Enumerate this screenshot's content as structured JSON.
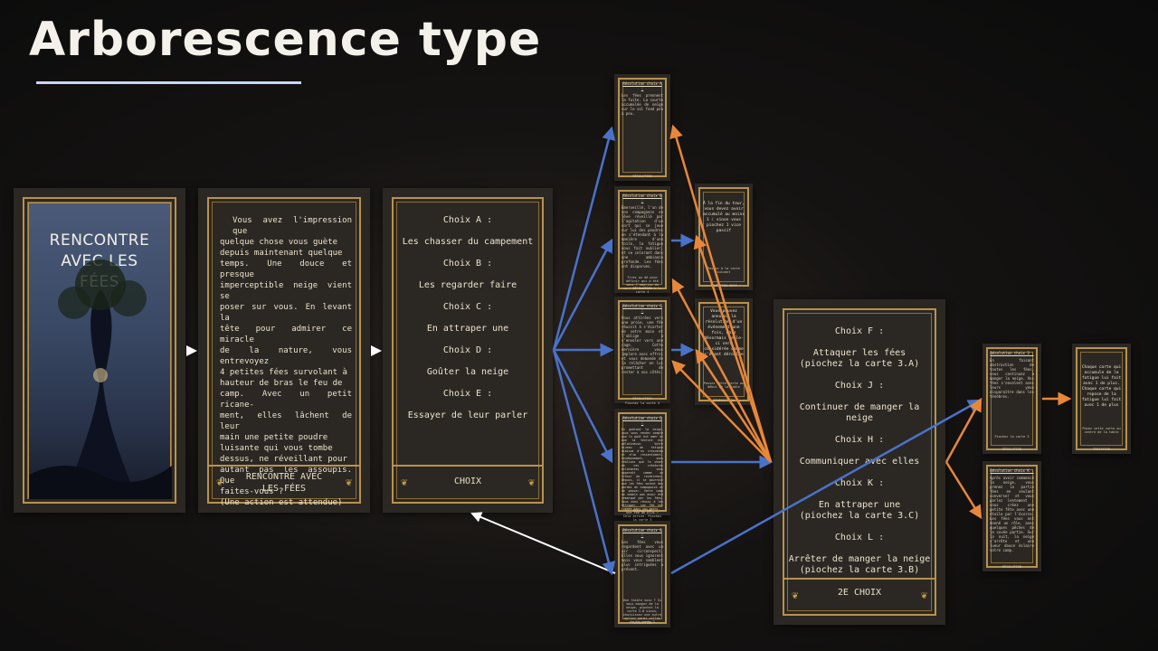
{
  "title": "Arborescence type",
  "cover": {
    "title_lines": [
      "RENCONTRE",
      "AVEC LES",
      "FÉES"
    ]
  },
  "intro": {
    "lines": [
      "Vous avez l'impression que",
      "quelque chose vous guète",
      "depuis maintenant quelque",
      "temps. Une douce et presque",
      "imperceptible neige vient se",
      "poser sur vous. En levant la",
      "tête pour admirer ce miracle",
      "de la nature, vous entrevoyez",
      "4 petites fées survolant à",
      "hauteur de bras le feu de",
      "camp. Avec un petit ricane-",
      "ment, elles lâchent de leur",
      "main une petite poudre",
      "luisante qui vous tombe",
      "dessus, ne réveillant pour",
      "autant pas les assoupis. Que",
      "faites-vous ?",
      "(Une action est attendue)"
    ],
    "footer": [
      "RENCONTRE AVEC",
      "LES FÉES"
    ]
  },
  "choices1": {
    "lines": [
      "Choix A :",
      "Les chasser du campement",
      "Choix B :",
      "Les regarder faire",
      "Choix C :",
      "En attraper une",
      "Choix D :",
      "Goûter la neige",
      "Choix E :",
      "Essayer de leur parler"
    ],
    "footer": "CHOIX"
  },
  "results": [
    {
      "head": "Résolution choix A :",
      "text": "Les fées prennent la fuite. La courte accumulée de neige sur le sol fond peu à peu.",
      "foot": "RÉSOLUTION"
    },
    {
      "head": "Résolution choix B :",
      "text": "Émerveillé, l'un de vos compagnons se lève réveillé par l'agitation d'un sort qui se joue sur lui des poudres en s'étendant à la manière d'une toile, la fatigue vous fait oublier, et se colorant dans une ambiance profonde. Les fées ont disparues.",
      "action": "Tirez au dé pour définir qui a été sous l'emprise du sort et Avancez à la carte 4",
      "foot": "RÉSOLUTION"
    },
    {
      "head": "Résolution choix C :",
      "text": "Vous attirées vers une proie, une fée réussit à s'écarter de votre main et l'oblige à s'envoler vers une rage. Cette dernière vous implore avec effroi et vous demande de la relâcher en lui promettant de rester à vos côtés.",
      "action": "Piochez la carte 4",
      "foot": "RÉSOLUTION"
    },
    {
      "head": "Résolution choix D :",
      "text": "En goûtant la neige, vous vous rendez compte que le goût est amer et que la texture est gélatineuse. Votre niveau de fatigue diminue d'un crescendo et d'un ressentiment. Soudainement, vous réalisez que le chant de ces créatures éclatantes vous apparaît comme un trésor de recherches. Depuis, il se pourrait que les fées soient des gardes de compagnies et de passer. Votre camp ne semble pas avoir été remarqué par les fées. Vous avez réussi à les attraper, une fée est tombée dans vos mains.",
      "action": "Une fée de plus ? Cela arrive. Piochez la carte 5",
      "foot": "RÉSOLUTION"
    },
    {
      "head": "Résolution choix E :",
      "text": "Les fées vous regardent avec un air circonspect. Elles vous ignorent mais vous semblent plus intriguées à présent.",
      "action": "Une faible voix ? Si vous mangez de la neige, piochez la carte 3.B sinon, choisissez une autre option parmi celles de la carte 3",
      "foot": "RÉSOLUTION"
    }
  ],
  "mid": [
    {
      "text": "À la fin du tour, vous devez avoir accumulé au moins 1 ☾ sinon vous piochez 1 vice passif",
      "action": "Passez à la carte suivant",
      "foot": "TENTATION 9BIS"
    },
    {
      "text": "Vous pouvez annuler la résolution d'un événement une fois, mais désormais celle-ci sera considérée comme s'étant déroulée",
      "action": "Passez cette carte au début de la table",
      "foot": "BÉNÉDICTION"
    }
  ],
  "choices2": {
    "lines": [
      "Choix F :",
      "Attaquer les fées",
      "(piochez la carte 3.A)",
      "Choix J :",
      "Continuer de manger la neige",
      "Choix H :",
      "Communiquer avec elles",
      "Choix K :",
      "En attraper une",
      "(piochez la carte 3.C)",
      "Choix L :",
      "Arrêter de manger la neige",
      "(piochez la carte 3.B)"
    ],
    "footer": "2E CHOIX"
  },
  "right": [
    {
      "head": "Résolution choix 3 :",
      "text": "En faisant abstraction de toutes les fées, vous continuez à manger la neige. Vos fées s'envolent avec leurs yeux disparaître dans les ténèbres.",
      "action": "Piochez la carte 3",
      "foot": "RÉSOLUTION"
    },
    {
      "head": "Résolution choix K :",
      "text": "Après avoir commencé la neige, vous prenez la partie fées en voulant converser et vous parlez lentement : vous créez une petite fête avec une étoile par l'écorce. Les fées vous ont donné un rôle, avec quelques pêches de la cuvée partie. Sur la nuit, la neige s'arrête et une lueur douce éclaire votre camp.",
      "foot": "RÉSOLUTION"
    },
    {
      "text": "Chaque carte qui accumule de la fatigue lui fait avec 1 de plus. Chaque carte qui repose de la fatigue lui fait avec 1 de plus",
      "action": "Posez cette carte au centre de la table",
      "foot": "TENTATION"
    }
  ],
  "colors": {
    "background": "#151312",
    "card": "#2b2824",
    "gold": "#b8924d",
    "arrow_blue": "#4a72c9",
    "arrow_orange": "#e8873a",
    "arrow_white": "#ffffff",
    "underline": "#c7d6f6"
  }
}
